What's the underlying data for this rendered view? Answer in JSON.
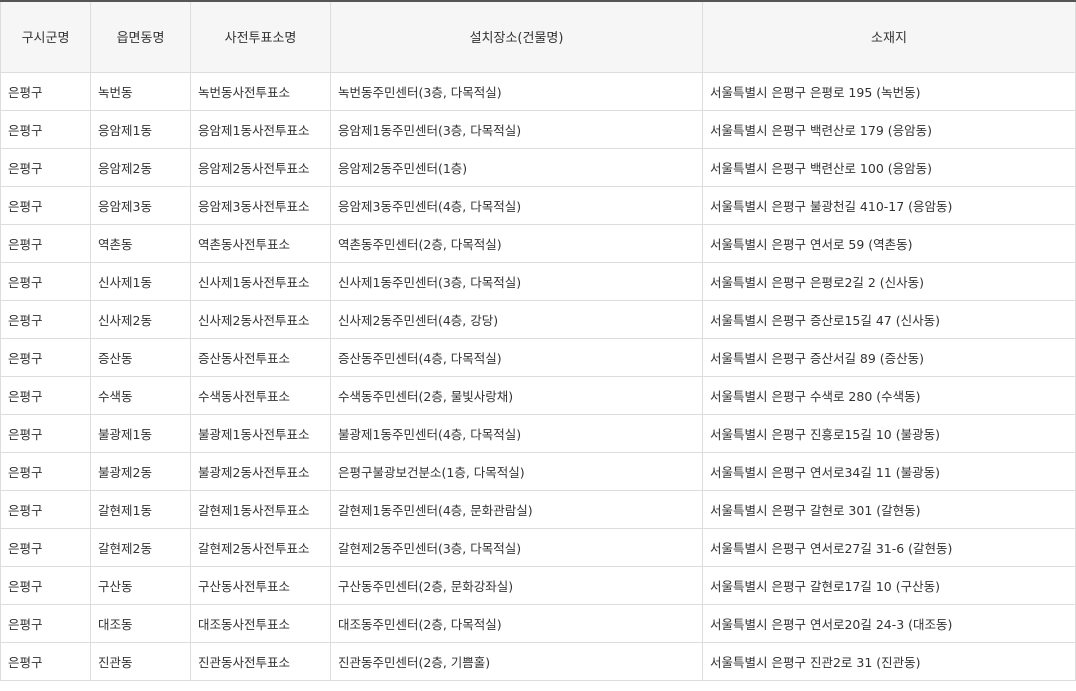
{
  "table": {
    "headers": [
      "구시군명",
      "읍면동명",
      "사전투표소명",
      "설치장소(건물명)",
      "소재지"
    ],
    "rows": [
      [
        "은평구",
        "녹번동",
        "녹번동사전투표소",
        "녹번동주민센터(3층, 다목적실)",
        "서울특별시 은평구 은평로 195 (녹번동)"
      ],
      [
        "은평구",
        "응암제1동",
        "응암제1동사전투표소",
        "응암제1동주민센터(3층, 다목적실)",
        "서울특별시 은평구 백련산로 179 (응암동)"
      ],
      [
        "은평구",
        "응암제2동",
        "응암제2동사전투표소",
        "응암제2동주민센터(1층)",
        "서울특별시 은평구 백련산로 100 (응암동)"
      ],
      [
        "은평구",
        "응암제3동",
        "응암제3동사전투표소",
        "응암제3동주민센터(4층, 다목적실)",
        "서울특별시 은평구 불광천길 410-17 (응암동)"
      ],
      [
        "은평구",
        "역촌동",
        "역촌동사전투표소",
        "역촌동주민센터(2층, 다목적실)",
        "서울특별시 은평구 연서로 59 (역촌동)"
      ],
      [
        "은평구",
        "신사제1동",
        "신사제1동사전투표소",
        "신사제1동주민센터(3층, 다목적실)",
        "서울특별시 은평구 은평로2길 2 (신사동)"
      ],
      [
        "은평구",
        "신사제2동",
        "신사제2동사전투표소",
        "신사제2동주민센터(4층, 강당)",
        "서울특별시 은평구 증산로15길 47 (신사동)"
      ],
      [
        "은평구",
        "증산동",
        "증산동사전투표소",
        "증산동주민센터(4층, 다목적실)",
        "서울특별시 은평구 증산서길 89 (증산동)"
      ],
      [
        "은평구",
        "수색동",
        "수색동사전투표소",
        "수색동주민센터(2층, 물빛사랑채)",
        "서울특별시 은평구 수색로 280 (수색동)"
      ],
      [
        "은평구",
        "불광제1동",
        "불광제1동사전투표소",
        "불광제1동주민센터(4층, 다목적실)",
        "서울특별시 은평구 진흥로15길 10 (불광동)"
      ],
      [
        "은평구",
        "불광제2동",
        "불광제2동사전투표소",
        "은평구불광보건분소(1층, 다목적실)",
        "서울특별시 은평구 연서로34길 11 (불광동)"
      ],
      [
        "은평구",
        "갈현제1동",
        "갈현제1동사전투표소",
        "갈현제1동주민센터(4층, 문화관람실)",
        "서울특별시 은평구 갈현로 301 (갈현동)"
      ],
      [
        "은평구",
        "갈현제2동",
        "갈현제2동사전투표소",
        "갈현제2동주민센터(3층, 다목적실)",
        "서울특별시 은평구 연서로27길 31-6 (갈현동)"
      ],
      [
        "은평구",
        "구산동",
        "구산동사전투표소",
        "구산동주민센터(2층, 문화강좌실)",
        "서울특별시 은평구 갈현로17길 10 (구산동)"
      ],
      [
        "은평구",
        "대조동",
        "대조동사전투표소",
        "대조동주민센터(2층, 다목적실)",
        "서울특별시 은평구 연서로20길 24-3 (대조동)"
      ],
      [
        "은평구",
        "진관동",
        "진관동사전투표소",
        "진관동주민센터(2층, 기쁨홀)",
        "서울특별시 은평구 진관2로 31 (진관동)"
      ]
    ]
  }
}
